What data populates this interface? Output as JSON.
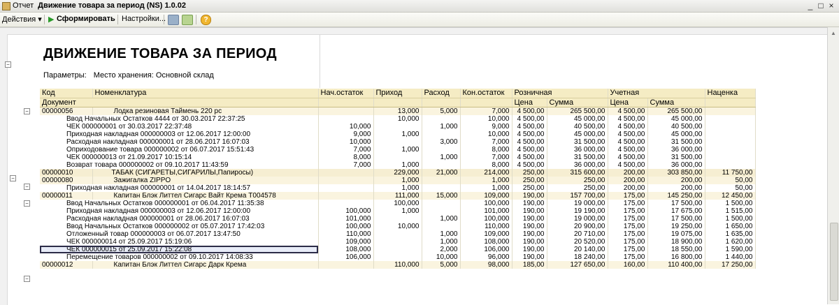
{
  "window": {
    "prefix": "Отчет",
    "title": "Движение товара за период (NS) 1.0.02",
    "controls": [
      "_",
      "□",
      "×"
    ]
  },
  "toolbar": {
    "actions": "Действия ▾",
    "generate": "Сформировать",
    "settings": "Настройки...",
    "help": "?"
  },
  "report": {
    "title": "ДВИЖЕНИЕ ТОВАРА ЗА ПЕРИОД",
    "params_label": "Параметры:",
    "params_value": "Место хранения: Основной склад"
  },
  "headers": {
    "row1": [
      "Код",
      "Номенклатура",
      "Нач.остаток",
      "Приход",
      "Расход",
      "Кон.остаток",
      "Розничная",
      "Учетная",
      "Наценка"
    ],
    "row2": [
      "Документ",
      "Цена",
      "Сумма",
      "Цена",
      "Сумма"
    ]
  },
  "rows": [
    {
      "kind": "g1",
      "code": "00000056",
      "name": "Лодка резиновая Таймень 220 pc",
      "v": [
        "",
        "13,000",
        "5,000",
        "7,000",
        "4 500,00",
        "265 500,00",
        "4 500,00",
        "265 500,00",
        ""
      ]
    },
    {
      "kind": "d",
      "doc": "Ввод Начальных Остатков 4444 от 30.03.2017 22:37:25",
      "v": [
        "",
        "10,000",
        "",
        "10,000",
        "4 500,00",
        "45 000,00",
        "4 500,00",
        "45 000,00",
        ""
      ]
    },
    {
      "kind": "d",
      "doc": "ЧЕК 000000001 от 30.03.2017 22:37:48",
      "v": [
        "10,000",
        "",
        "1,000",
        "9,000",
        "4 500,00",
        "40 500,00",
        "4 500,00",
        "40 500,00",
        ""
      ]
    },
    {
      "kind": "d",
      "doc": "Приходная накладная 000000003 от 12.06.2017 12:00:00",
      "v": [
        "9,000",
        "1,000",
        "",
        "10,000",
        "4 500,00",
        "45 000,00",
        "4 500,00",
        "45 000,00",
        ""
      ]
    },
    {
      "kind": "d",
      "doc": "Расходная накладная 000000001 от 28.06.2017 16:07:03",
      "v": [
        "10,000",
        "",
        "3,000",
        "7,000",
        "4 500,00",
        "31 500,00",
        "4 500,00",
        "31 500,00",
        ""
      ]
    },
    {
      "kind": "d",
      "doc": "Оприходование товара 000000002 от 06.07.2017 15:51:43",
      "v": [
        "7,000",
        "1,000",
        "",
        "8,000",
        "4 500,00",
        "36 000,00",
        "4 500,00",
        "36 000,00",
        ""
      ]
    },
    {
      "kind": "d",
      "doc": "ЧЕК 000000013 от 21.09.2017 10:15:14",
      "v": [
        "8,000",
        "",
        "1,000",
        "7,000",
        "4 500,00",
        "31 500,00",
        "4 500,00",
        "31 500,00",
        ""
      ]
    },
    {
      "kind": "d",
      "doc": "Возврат товара 000000002 от 09.10.2017 11:43:59",
      "v": [
        "7,000",
        "1,000",
        "",
        "8,000",
        "4 500,00",
        "36 000,00",
        "4 500,00",
        "36 000,00",
        ""
      ]
    },
    {
      "kind": "g0",
      "code": "00000010",
      "name": "ТАБАК (СИГАРЕТЫ,СИГАРИЛЫ,Папиросы)",
      "v": [
        "",
        "229,000",
        "21,000",
        "214,000",
        "250,00",
        "315 600,00",
        "200,00",
        "303 850,00",
        "11 750,00"
      ]
    },
    {
      "kind": "g1",
      "code": "00000080",
      "name": "Зажигалка ZIPPO",
      "v": [
        "",
        "1,000",
        "",
        "1,000",
        "250,00",
        "250,00",
        "200,00",
        "200,00",
        "50,00"
      ]
    },
    {
      "kind": "d",
      "doc": "Приходная накладная 000000001 от 14.04.2017 18:14:57",
      "v": [
        "",
        "1,000",
        "",
        "1,000",
        "250,00",
        "250,00",
        "200,00",
        "200,00",
        "50,00"
      ]
    },
    {
      "kind": "g1",
      "code": "00000011",
      "name": "Капитан Блэк Литтел Сигарс Вайт Крема T004578",
      "v": [
        "",
        "111,000",
        "15,000",
        "109,000",
        "190,00",
        "157 700,00",
        "175,00",
        "145 250,00",
        "12 450,00"
      ]
    },
    {
      "kind": "d",
      "doc": "Ввод Начальных Остатков 000000001 от 06.04.2017 11:35:38",
      "v": [
        "",
        "100,000",
        "",
        "100,000",
        "190,00",
        "19 000,00",
        "175,00",
        "17 500,00",
        "1 500,00"
      ]
    },
    {
      "kind": "d",
      "doc": "Приходная накладная 000000003 от 12.06.2017 12:00:00",
      "v": [
        "100,000",
        "1,000",
        "",
        "101,000",
        "190,00",
        "19 190,00",
        "175,00",
        "17 675,00",
        "1 515,00"
      ]
    },
    {
      "kind": "d",
      "doc": "Расходная накладная 000000001 от 28.06.2017 16:07:03",
      "v": [
        "101,000",
        "",
        "1,000",
        "100,000",
        "190,00",
        "19 000,00",
        "175,00",
        "17 500,00",
        "1 500,00"
      ]
    },
    {
      "kind": "d",
      "doc": "Ввод Начальных Остатков 000000002 от 05.07.2017 17:42:03",
      "v": [
        "100,000",
        "10,000",
        "",
        "110,000",
        "190,00",
        "20 900,00",
        "175,00",
        "19 250,00",
        "1 650,00"
      ]
    },
    {
      "kind": "d",
      "doc": "Отложенный товар 000000003 от 06.07.2017 13:47:50",
      "v": [
        "110,000",
        "",
        "1,000",
        "109,000",
        "190,00",
        "20 710,00",
        "175,00",
        "19 075,00",
        "1 635,00"
      ]
    },
    {
      "kind": "d",
      "doc": "ЧЕК 000000014 от 25.09.2017 15:19:06",
      "v": [
        "109,000",
        "",
        "1,000",
        "108,000",
        "190,00",
        "20 520,00",
        "175,00",
        "18 900,00",
        "1 620,00"
      ]
    },
    {
      "kind": "sel",
      "doc": "ЧЕК 000000015 от 25.09.2017 15:22:08",
      "v": [
        "108,000",
        "",
        "2,000",
        "106,000",
        "190,00",
        "20 140,00",
        "175,00",
        "18 550,00",
        "1 590,00"
      ]
    },
    {
      "kind": "d",
      "doc": "Перемещение товаров 000000002 от 09.10.2017 14:08:33",
      "v": [
        "106,000",
        "",
        "10,000",
        "96,000",
        "190,00",
        "18 240,00",
        "175,00",
        "16 800,00",
        "1 440,00"
      ]
    },
    {
      "kind": "g1",
      "code": "00000012",
      "name": "Капитан Блэк Литтел Сигарс Дарк Крема",
      "v": [
        "",
        "110,000",
        "5,000",
        "98,000",
        "185,00",
        "127 650,00",
        "160,00",
        "110 400,00",
        "17 250,00"
      ]
    }
  ],
  "icons": {
    "app": "report-icon",
    "generate": "play-arrow-icon",
    "grid": "grid-icon",
    "export": "export-icon",
    "help": "help-icon",
    "collapse": "tree-collapse-icon"
  },
  "colors": {
    "header_bg": "#f5ecc4",
    "group_bg": "#f6eed2",
    "generate_green": "#2a9a2a"
  }
}
